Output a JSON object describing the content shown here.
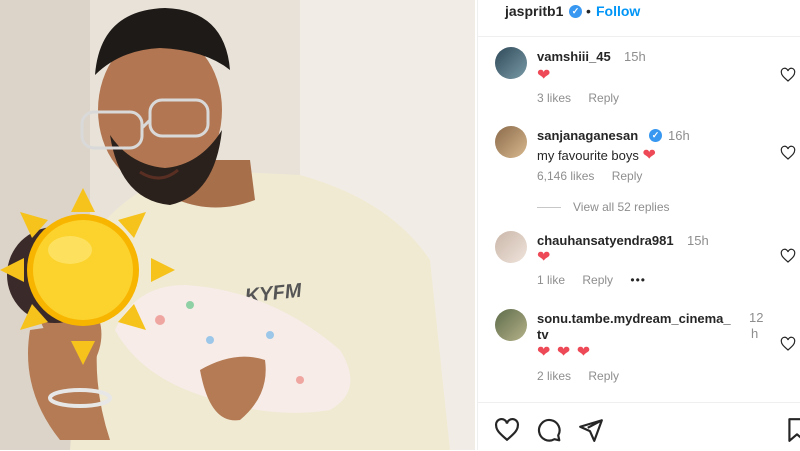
{
  "post": {
    "author": "jaspritb1",
    "follow_label": "Follow",
    "separator": "•"
  },
  "comments": [
    {
      "user": "vamshiii_45",
      "time": "15h",
      "text": "❤",
      "likes": "3 likes",
      "reply": "Reply"
    },
    {
      "user": "sanjanaganesan",
      "time": "16h",
      "text": "my favourite boys",
      "emoji": "❤",
      "likes": "6,146 likes",
      "reply": "Reply"
    },
    {
      "user": "chauhansatyendra981",
      "time": "15h",
      "text": "❤",
      "likes": "1 like",
      "reply": "Reply",
      "more": "•••"
    },
    {
      "user_line1": "sonu.tambe.mydream_cinema_",
      "user_line2": "tv",
      "time_line1": "12",
      "time_line2": "h",
      "text": "❤ ❤ ❤",
      "likes": "2 likes",
      "reply": "Reply"
    }
  ],
  "view_replies": "View all 52 replies",
  "photo": {
    "shirt_print": "KYFM",
    "sticker": "sun-emoji"
  },
  "icons": [
    "heart-icon",
    "comment-icon",
    "share-icon",
    "save-icon"
  ],
  "colors": {
    "accent": "#0095f6",
    "heart": "#ed4956",
    "muted": "#8e8e8e"
  }
}
